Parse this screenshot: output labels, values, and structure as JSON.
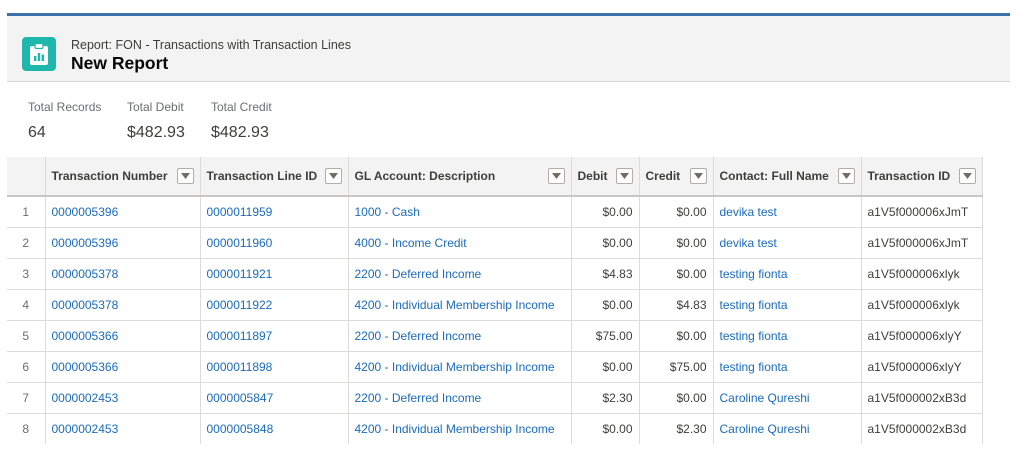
{
  "header": {
    "subtitle": "Report: FON - Transactions with Transaction Lines",
    "title": "New Report",
    "icon": "report-icon"
  },
  "summary": [
    {
      "label": "Total Records",
      "value": "64"
    },
    {
      "label": "Total Debit",
      "value": "$482.93"
    },
    {
      "label": "Total Credit",
      "value": "$482.93"
    }
  ],
  "table": {
    "columns": [
      "Transaction Number",
      "Transaction Line ID",
      "GL Account: Description",
      "Debit",
      "Credit",
      "Contact: Full Name",
      "Transaction ID"
    ],
    "rows": [
      {
        "n": "1",
        "txn": "0000005396",
        "line": "0000011959",
        "gl": "1000 - Cash",
        "debit": "$0.00",
        "credit": "$0.00",
        "contact": "devika test",
        "tid": "a1V5f000006xJmT"
      },
      {
        "n": "2",
        "txn": "0000005396",
        "line": "0000011960",
        "gl": "4000 - Income Credit",
        "debit": "$0.00",
        "credit": "$0.00",
        "contact": "devika test",
        "tid": "a1V5f000006xJmT"
      },
      {
        "n": "3",
        "txn": "0000005378",
        "line": "0000011921",
        "gl": "2200 - Deferred Income",
        "debit": "$4.83",
        "credit": "$0.00",
        "contact": "testing fionta",
        "tid": "a1V5f000006xlyk"
      },
      {
        "n": "4",
        "txn": "0000005378",
        "line": "0000011922",
        "gl": "4200 - Individual Membership Income",
        "debit": "$0.00",
        "credit": "$4.83",
        "contact": "testing fionta",
        "tid": "a1V5f000006xlyk"
      },
      {
        "n": "5",
        "txn": "0000005366",
        "line": "0000011897",
        "gl": "2200 - Deferred Income",
        "debit": "$75.00",
        "credit": "$0.00",
        "contact": "testing fionta",
        "tid": "a1V5f000006xlyY"
      },
      {
        "n": "6",
        "txn": "0000005366",
        "line": "0000011898",
        "gl": "4200 - Individual Membership Income",
        "debit": "$0.00",
        "credit": "$75.00",
        "contact": "testing fionta",
        "tid": "a1V5f000006xlyY"
      },
      {
        "n": "7",
        "txn": "0000002453",
        "line": "0000005847",
        "gl": "2200 - Deferred Income",
        "debit": "$2.30",
        "credit": "$0.00",
        "contact": "Caroline Qureshi",
        "tid": "a1V5f000002xB3d"
      },
      {
        "n": "8",
        "txn": "0000002453",
        "line": "0000005848",
        "gl": "4200 - Individual Membership Income",
        "debit": "$0.00",
        "credit": "$2.30",
        "contact": "Caroline Qureshi",
        "tid": "a1V5f000002xB3d"
      }
    ]
  },
  "colors": {
    "accent_line": "#3d6fa8",
    "icon_bg": "#1fb7ac",
    "link": "#1a6bbd"
  }
}
